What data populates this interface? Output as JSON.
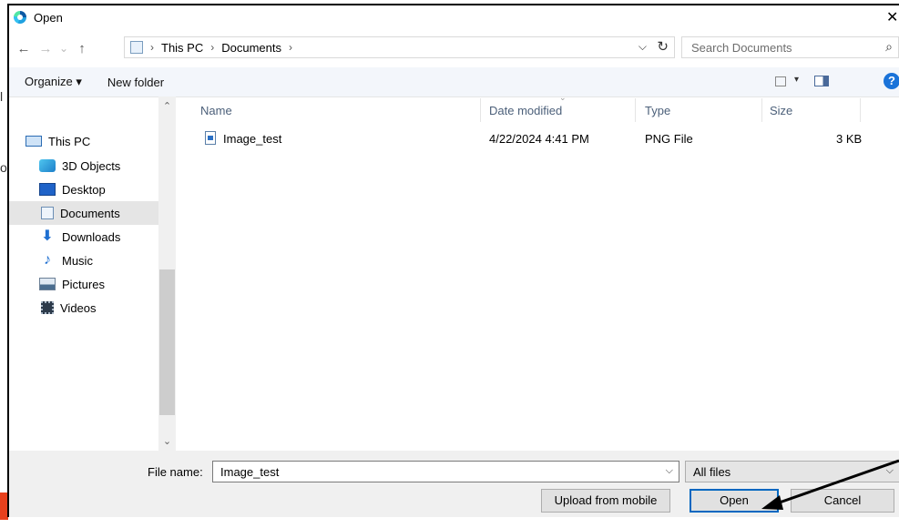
{
  "window": {
    "title": "Open",
    "close_glyph": "✕"
  },
  "address": {
    "back_glyph": "←",
    "forward_glyph": "→",
    "recent_glyph": "⌄",
    "up_glyph": "↑",
    "crumbs": [
      "This PC",
      "Documents"
    ],
    "separator": "›",
    "dropdown_glyph": "⌵",
    "refresh_glyph": "↻",
    "search_placeholder": "Search Documents",
    "search_glyph": "⌕"
  },
  "toolbar": {
    "organize_label": "Organize ▾",
    "new_folder_label": "New folder",
    "view_dropdown_glyph": "▾",
    "help_glyph": "?"
  },
  "nav": {
    "items": [
      {
        "label": "This PC",
        "icon": "monitor-icon"
      },
      {
        "label": "3D Objects",
        "icon": "cube-icon"
      },
      {
        "label": "Desktop",
        "icon": "desktop-icon"
      },
      {
        "label": "Documents",
        "icon": "document-icon",
        "selected": true
      },
      {
        "label": "Downloads",
        "icon": "download-icon"
      },
      {
        "label": "Music",
        "icon": "music-icon"
      },
      {
        "label": "Pictures",
        "icon": "pictures-icon"
      },
      {
        "label": "Videos",
        "icon": "video-icon"
      }
    ],
    "scroll_up_glyph": "⌃",
    "scroll_down_glyph": "⌄"
  },
  "files": {
    "columns": [
      "Name",
      "Date modified",
      "Type",
      "Size"
    ],
    "sort_glyph": "⌄",
    "rows": [
      {
        "name": "Image_test",
        "date": "4/22/2024 4:41 PM",
        "type": "PNG File",
        "size": "3 KB"
      }
    ]
  },
  "footer": {
    "file_name_label": "File name:",
    "file_name_value": "Image_test",
    "dropdown_glyph": "⌵",
    "filter_value": "All files",
    "buttons": {
      "upload": "Upload from mobile",
      "open": "Open",
      "cancel": "Cancel"
    }
  },
  "background": {
    "char_1": "l",
    "char_2": "o"
  },
  "colors": {
    "accent": "#0067c0",
    "selection": "#e5e5e5",
    "toolbar_bg": "#f3f6fb",
    "annotation_arrow": "#000000"
  }
}
